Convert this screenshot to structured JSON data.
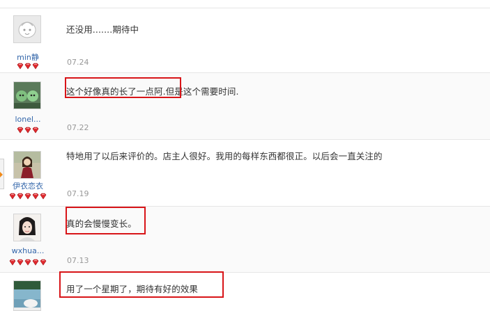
{
  "reviews": [
    {
      "user": "min静",
      "text": "还没用.......期待中",
      "date": "07.24",
      "stars": 3,
      "avatar": "cartoon-face",
      "highlighted": false
    },
    {
      "user": "lonel...",
      "text": "这个好像真的长了一点阿.但是这个需要时间.",
      "date": "07.22",
      "stars": 3,
      "avatar": "green-figures",
      "highlighted": true
    },
    {
      "user": "伊衣恋衣",
      "text": "特地用了以后来评价的。店主人很好。我用的每样东西都很正。以后会一直关注的",
      "date": "07.19",
      "stars": 5,
      "avatar": "woman-portrait",
      "highlighted": false
    },
    {
      "user": "wxhua...",
      "text": "真的会慢慢变长。",
      "date": "07.13",
      "stars": 5,
      "avatar": "girl-selfie",
      "highlighted": true
    },
    {
      "user": "",
      "text": "用了一个星期了，期待有好的效果",
      "date": "",
      "stars": 0,
      "avatar": "lake-photo",
      "highlighted": true
    }
  ],
  "colors": {
    "highlight": "#d81418",
    "rank_gem": "#e0282d",
    "username": "#3366aa"
  }
}
